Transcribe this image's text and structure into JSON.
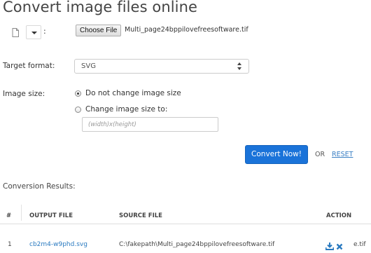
{
  "page": {
    "title": "Convert image files online"
  },
  "toolbar": {
    "colon": ":",
    "choose_file_label": "Choose File",
    "chosen_file_name": "Multi_page24bppilovefreesoftware.tif"
  },
  "form": {
    "target_format_label": "Target format:",
    "target_format_value": "SVG",
    "image_size_label": "Image size:",
    "option_keep": "Do not change image size",
    "option_change": "Change image size to:",
    "size_placeholder": "(width)x(height)",
    "selected_option": "keep"
  },
  "actions": {
    "convert_label": "Convert Now!",
    "or_text": "OR",
    "reset_label": "RESET"
  },
  "results": {
    "title": "Conversion Results:",
    "columns": [
      "#",
      "OUTPUT FILE",
      "SOURCE FILE",
      "ACTION"
    ],
    "rows": [
      {
        "num": "1",
        "output": "cb2m4-w9phd.svg",
        "source": "C:\\fakepath\\Multi_page24bppilovefreesoftware.tif",
        "ext": "e.tif"
      }
    ]
  },
  "colors": {
    "primary": "#1a73d9",
    "link": "#2a7ac0"
  },
  "icons": [
    "file-icon",
    "chevron-down-icon",
    "download-icon",
    "delete-icon"
  ]
}
